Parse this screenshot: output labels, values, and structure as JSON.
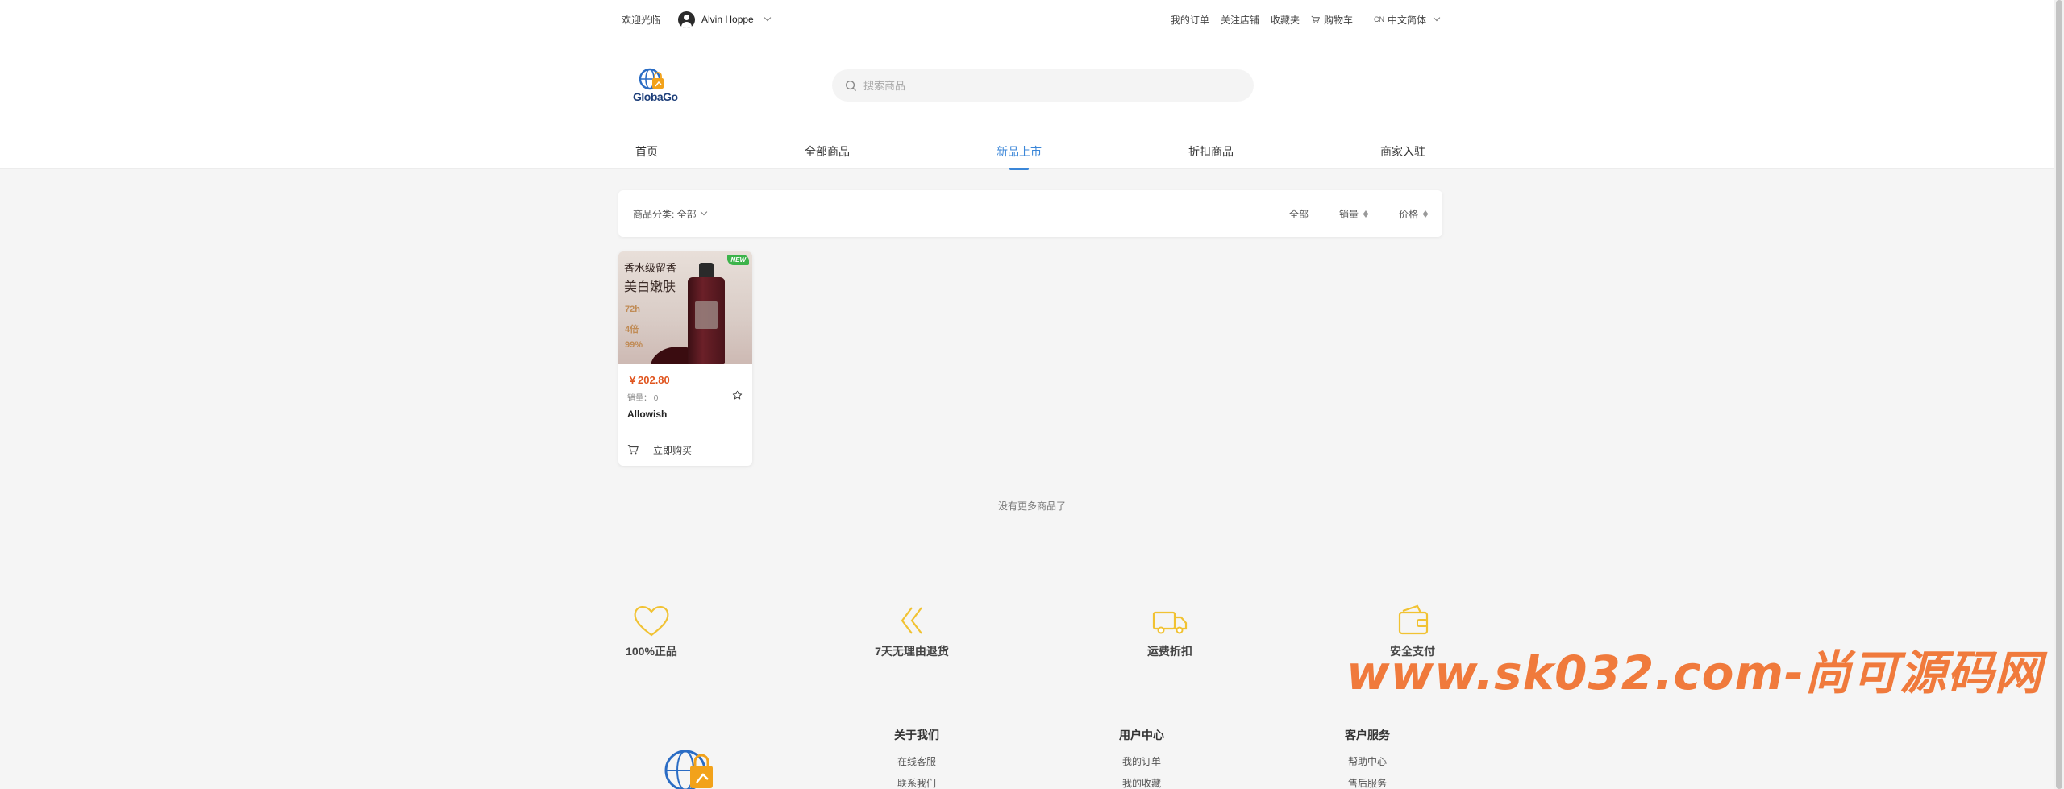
{
  "topbar": {
    "welcome": "欢迎光临",
    "username": "Alvin Hoppe",
    "links": {
      "orders": "我的订单",
      "follow_shop": "关注店铺",
      "favorites": "收藏夹",
      "cart": "购物车"
    },
    "lang_code": "CN",
    "lang_label": "中文简体"
  },
  "logo": {
    "text": "GlobaGo"
  },
  "search": {
    "placeholder": "搜索商品",
    "value": ""
  },
  "nav": {
    "items": [
      {
        "label": "首页"
      },
      {
        "label": "全部商品"
      },
      {
        "label": "新品上市",
        "active": true
      },
      {
        "label": "折扣商品"
      },
      {
        "label": "商家入驻"
      }
    ]
  },
  "filter": {
    "category": "商品分类: 全部",
    "sort_all": "全部",
    "sort_sales": "销量",
    "sort_price": "价格"
  },
  "product": {
    "image_text_1": "香水级留香",
    "image_text_2": "美白嫩肤",
    "image_spec_1": "72h",
    "image_spec_2": "4倍",
    "image_spec_3": "99%",
    "badge": "NEW",
    "price": "￥202.80",
    "sales": "销量： 0",
    "name": "Allowish",
    "buy_label": "立即购买"
  },
  "no_more": "没有更多商品了",
  "features": [
    {
      "label": "100%正品",
      "icon": "heart-icon"
    },
    {
      "label": "7天无理由退货",
      "icon": "double-chevron-left-icon"
    },
    {
      "label": "运费折扣",
      "icon": "truck-icon"
    },
    {
      "label": "安全支付",
      "icon": "wallet-icon"
    }
  ],
  "footer": {
    "about": {
      "title": "关于我们",
      "links": [
        "在线客服",
        "联系我们"
      ]
    },
    "user": {
      "title": "用户中心",
      "links": [
        "我的订单",
        "我的收藏"
      ]
    },
    "service": {
      "title": "客户服务",
      "links": [
        "帮助中心",
        "售后服务"
      ]
    }
  },
  "watermark": "www.sk032.com-尚可源码网",
  "colors": {
    "accent": "#3a86d8",
    "price": "#e0551f",
    "feature_icon": "#f1c232",
    "badge": "#3cb34a"
  }
}
